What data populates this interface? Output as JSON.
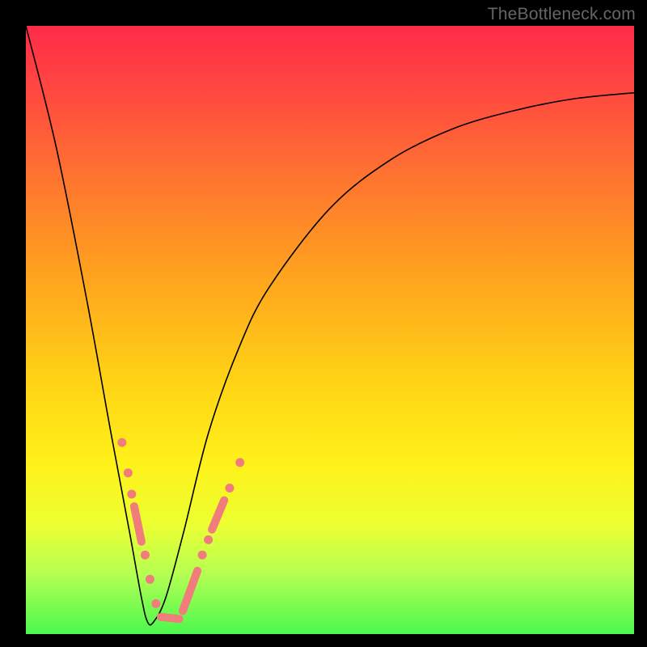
{
  "watermark": {
    "text": "TheBottleneck.com"
  },
  "colors": {
    "black": "#000000",
    "bead": "#f07c7c",
    "watermark": "#666666",
    "gradient_top": "#ff2b49",
    "gradient_bottom": "#4bf84f"
  },
  "chart_data": {
    "type": "line",
    "title": "",
    "xlabel": "",
    "ylabel": "",
    "xlim": [
      0,
      100
    ],
    "ylim": [
      0,
      100
    ],
    "grid": false,
    "note": "V-shaped curve on a vertical red→green gradient; minimum near x≈20. No numeric axis labels shown; values are visual estimates of curve height (100=top, 0=bottom).",
    "series": [
      {
        "name": "curve",
        "x": [
          0,
          5,
          10,
          14,
          17,
          19,
          20,
          21,
          23,
          26,
          30,
          35,
          40,
          50,
          60,
          70,
          80,
          90,
          100
        ],
        "values": [
          100,
          80,
          55,
          33,
          17,
          6,
          2,
          2,
          6,
          17,
          33,
          47,
          57,
          70,
          78,
          83,
          86,
          88,
          89
        ]
      }
    ],
    "beads": {
      "note": "Salmon bead clusters along both arms near the trough; positions in plot-area fraction coordinates (0..1 from top-left).",
      "points": [
        {
          "fx": 0.158,
          "fy": 0.685
        },
        {
          "fx": 0.168,
          "fy": 0.735
        },
        {
          "fx": 0.174,
          "fy": 0.77
        },
        {
          "fx": 0.196,
          "fy": 0.87
        },
        {
          "fx": 0.204,
          "fy": 0.91
        },
        {
          "fx": 0.214,
          "fy": 0.95
        },
        {
          "fx": 0.29,
          "fy": 0.87
        },
        {
          "fx": 0.3,
          "fy": 0.845
        },
        {
          "fx": 0.335,
          "fy": 0.76
        },
        {
          "fx": 0.352,
          "fy": 0.718
        }
      ],
      "pills": [
        {
          "fx1": 0.178,
          "fy1": 0.79,
          "fx2": 0.19,
          "fy2": 0.848
        },
        {
          "fx1": 0.222,
          "fy1": 0.972,
          "fx2": 0.252,
          "fy2": 0.975
        },
        {
          "fx1": 0.258,
          "fy1": 0.962,
          "fx2": 0.282,
          "fy2": 0.896
        },
        {
          "fx1": 0.306,
          "fy1": 0.828,
          "fx2": 0.326,
          "fy2": 0.78
        }
      ]
    }
  }
}
